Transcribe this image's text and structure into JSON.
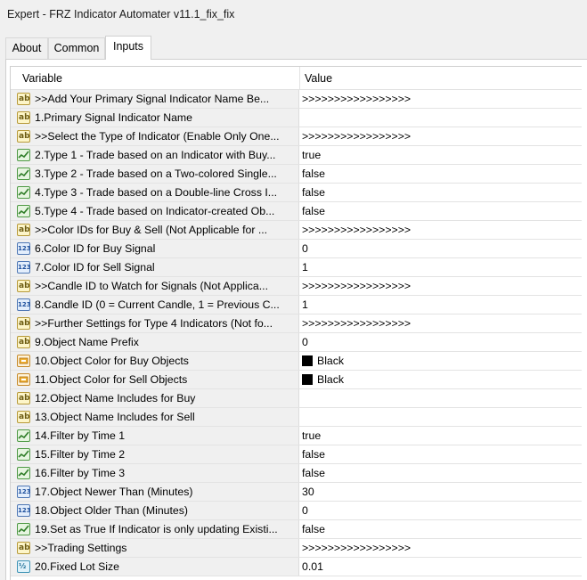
{
  "window": {
    "title": "Expert - FRZ Indicator Automater v11.1_fix_fix"
  },
  "tabs": [
    {
      "label": "About",
      "active": false
    },
    {
      "label": "Common",
      "active": false
    },
    {
      "label": "Inputs",
      "active": true
    }
  ],
  "grid": {
    "headers": {
      "variable": "Variable",
      "value": "Value"
    },
    "rows": [
      {
        "icon": "string-icon",
        "variable": ">>Add Your Primary Signal Indicator Name Be...",
        "value": ">>>>>>>>>>>>>>>>>"
      },
      {
        "icon": "string-icon",
        "variable": "1.Primary Signal Indicator Name",
        "value": ""
      },
      {
        "icon": "string-icon",
        "variable": ">>Select the Type of Indicator (Enable Only One...",
        "value": ">>>>>>>>>>>>>>>>>"
      },
      {
        "icon": "boolean-icon",
        "variable": "2.Type 1 - Trade based on an Indicator with Buy...",
        "value": "true"
      },
      {
        "icon": "boolean-icon",
        "variable": "3.Type 2 - Trade based on a Two-colored Single...",
        "value": "false"
      },
      {
        "icon": "boolean-icon",
        "variable": "4.Type 3 - Trade based on a Double-line Cross I...",
        "value": "false"
      },
      {
        "icon": "boolean-icon",
        "variable": "5.Type 4 - Trade based on Indicator-created Ob...",
        "value": "false"
      },
      {
        "icon": "string-icon",
        "variable": ">>Color IDs for Buy & Sell (Not Applicable for ...",
        "value": ">>>>>>>>>>>>>>>>>"
      },
      {
        "icon": "integer-icon",
        "variable": "6.Color ID for Buy Signal",
        "value": "0"
      },
      {
        "icon": "integer-icon",
        "variable": "7.Color ID for Sell Signal",
        "value": "1"
      },
      {
        "icon": "string-icon",
        "variable": ">>Candle ID to Watch for Signals  (Not Applica...",
        "value": ">>>>>>>>>>>>>>>>>"
      },
      {
        "icon": "integer-icon",
        "variable": "8.Candle ID (0 = Current Candle, 1 = Previous C...",
        "value": "1"
      },
      {
        "icon": "string-icon",
        "variable": ">>Further Settings for Type 4 Indicators (Not fo...",
        "value": ">>>>>>>>>>>>>>>>>"
      },
      {
        "icon": "string-icon",
        "variable": "9.Object Name Prefix",
        "value": "0"
      },
      {
        "icon": "color-icon",
        "variable": "10.Object Color for Buy Objects",
        "value": "Black",
        "swatch": "#000000"
      },
      {
        "icon": "color-icon",
        "variable": "11.Object Color for Sell Objects",
        "value": "Black",
        "swatch": "#000000"
      },
      {
        "icon": "string-icon",
        "variable": "12.Object Name Includes for Buy",
        "value": ""
      },
      {
        "icon": "string-icon",
        "variable": "13.Object Name Includes for Sell",
        "value": ""
      },
      {
        "icon": "boolean-icon",
        "variable": "14.Filter by Time 1",
        "value": "true"
      },
      {
        "icon": "boolean-icon",
        "variable": "15.Filter by Time 2",
        "value": "false"
      },
      {
        "icon": "boolean-icon",
        "variable": "16.Filter by Time 3",
        "value": "false"
      },
      {
        "icon": "integer-icon",
        "variable": "17.Object Newer Than (Minutes)",
        "value": "30"
      },
      {
        "icon": "integer-icon",
        "variable": "18.Object Older Than (Minutes)",
        "value": "0"
      },
      {
        "icon": "boolean-icon",
        "variable": "19.Set as True If Indicator is only updating Existi...",
        "value": "false"
      },
      {
        "icon": "string-icon",
        "variable": ">>Trading Settings",
        "value": ">>>>>>>>>>>>>>>>>"
      },
      {
        "icon": "double-icon",
        "variable": "20.Fixed Lot Size",
        "value": "0.01"
      }
    ]
  },
  "colors": {
    "row_label_bg": "#f0f0f0",
    "value_bg": "#ffffff",
    "grid_line": "#e3e3e3"
  }
}
